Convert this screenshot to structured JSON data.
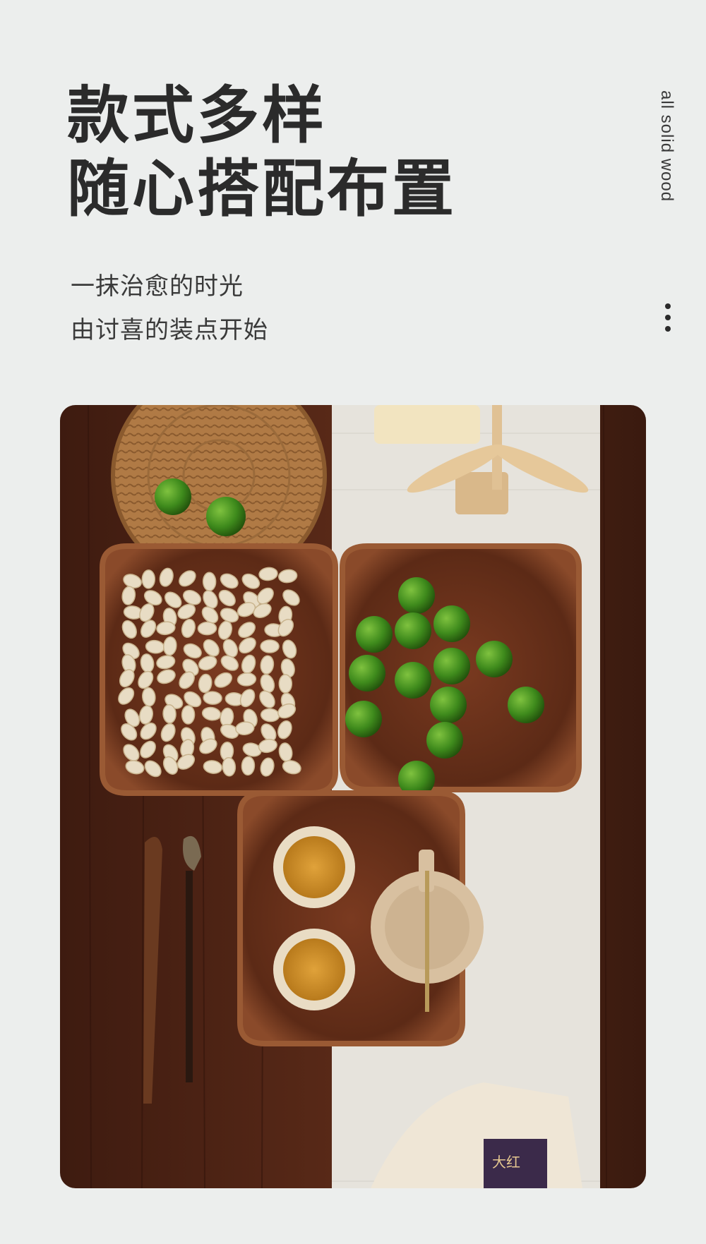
{
  "header": {
    "title_line1": "款式多样",
    "title_line2": "随心搭配布置",
    "vertical_text": "all solid wood"
  },
  "subtitle": {
    "line1": "一抹治愈的时光",
    "line2": "由讨喜的装点开始"
  },
  "photo": {
    "package_label": "大红"
  },
  "colors": {
    "background": "#eceeed",
    "text": "#2b2b2b",
    "wood_dark": "#4a2417",
    "wood_mid": "#7a3a22",
    "lime": "#3f8c1f"
  }
}
